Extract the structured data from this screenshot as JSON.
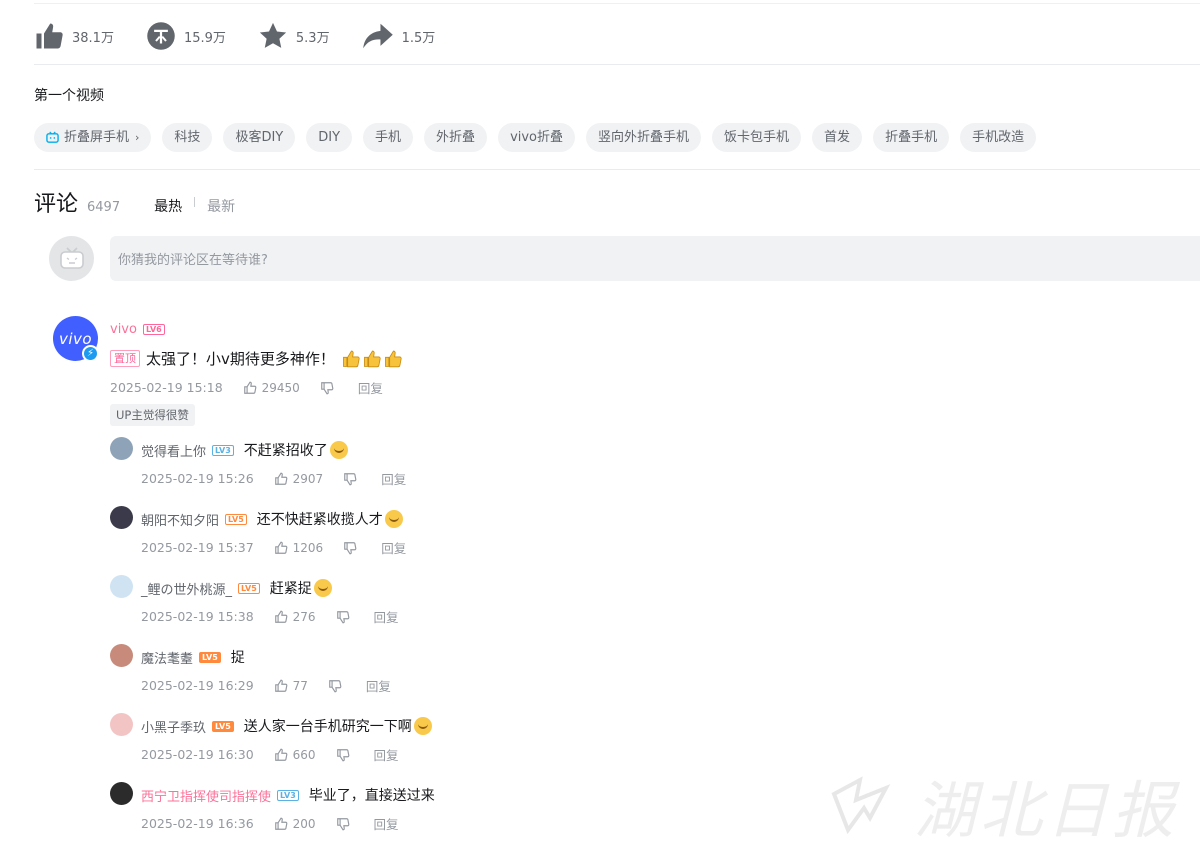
{
  "actions": {
    "like_count": "38.1万",
    "coin_count": "15.9万",
    "favorite_count": "5.3万",
    "share_count": "1.5万"
  },
  "description": "第一个视频",
  "tags": [
    {
      "label": "折叠屏手机",
      "has_icon": true,
      "has_chevron": true
    },
    {
      "label": "科技"
    },
    {
      "label": "极客DIY"
    },
    {
      "label": "DIY"
    },
    {
      "label": "手机"
    },
    {
      "label": "外折叠"
    },
    {
      "label": "vivo折叠"
    },
    {
      "label": "竖向外折叠手机"
    },
    {
      "label": "饭卡包手机"
    },
    {
      "label": "首发"
    },
    {
      "label": "折叠手机"
    },
    {
      "label": "手机改造"
    }
  ],
  "comments": {
    "title": "评论",
    "count": "6497",
    "sort_hot": "最热",
    "sort_new": "最新",
    "input_placeholder": "你猜我的评论区在等待谁?",
    "root": {
      "avatar_text": "vivo",
      "username": "vivo",
      "level": "LV6",
      "pin_label": "置顶",
      "text": "太强了！小v期待更多神作！",
      "time": "2025-02-19 15:18",
      "likes": "29450",
      "reply_label": "回复",
      "up_liked": "UP主觉得很赞"
    },
    "replies": [
      {
        "username": "觉得看上你",
        "level": "LV3",
        "text": "不赶紧招收了",
        "time": "2025-02-19 15:26",
        "likes": "2907",
        "reply_label": "回复",
        "name_color": "#61666d"
      },
      {
        "username": "朝阳不知夕阳",
        "level": "LV5",
        "text": "还不快赶紧收揽人才",
        "time": "2025-02-19 15:37",
        "likes": "1206",
        "reply_label": "回复",
        "name_color": "#61666d"
      },
      {
        "username": "_鲤の世外桃源_",
        "level": "LV5",
        "text": "赶紧捉",
        "time": "2025-02-19 15:38",
        "likes": "276",
        "reply_label": "回复",
        "name_color": "#61666d"
      },
      {
        "username": "魔法耄耋",
        "level": "LV5",
        "text": "捉",
        "time": "2025-02-19 16:29",
        "likes": "77",
        "reply_label": "回复",
        "name_color": "#61666d"
      },
      {
        "username": "小黑子季玖",
        "level": "LV5",
        "text": "送人家一台手机研究一下啊",
        "time": "2025-02-19 16:30",
        "likes": "660",
        "reply_label": "回复",
        "name_color": "#61666d"
      },
      {
        "username": "西宁卫指挥使司指挥使",
        "level": "LV3",
        "text": "毕业了，直接送过来",
        "time": "2025-02-19 16:36",
        "likes": "200",
        "reply_label": "回复",
        "name_color": "#fb7299"
      }
    ]
  },
  "watermark": {
    "text": "湖北日报"
  },
  "colors": {
    "accent_pink": "#fb7299",
    "muted": "#9499a0",
    "tag_bg": "#f1f2f3"
  }
}
